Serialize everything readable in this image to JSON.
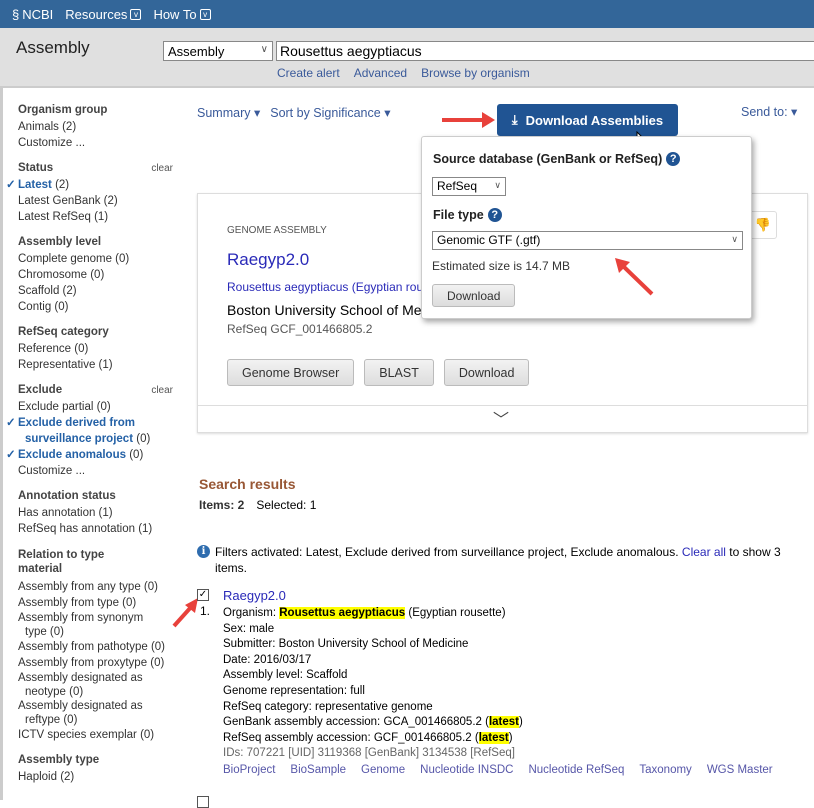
{
  "header": {
    "logo": "NCBI",
    "menus": [
      "Resources",
      "How To"
    ]
  },
  "search": {
    "db_title": "Assembly",
    "db_select": "Assembly",
    "query": "Rousettus aegyptiacus",
    "links": [
      "Create alert",
      "Advanced",
      "Browse by organism"
    ]
  },
  "sidebar": {
    "organism_group": {
      "title": "Organism group",
      "items": [
        "Animals (2)",
        "Customize ..."
      ]
    },
    "status": {
      "title": "Status",
      "clear": "clear",
      "checked": "Latest",
      "checked_count": "(2)",
      "items": [
        "Latest GenBank (2)",
        "Latest RefSeq (1)"
      ]
    },
    "assembly_level": {
      "title": "Assembly level",
      "items": [
        "Complete genome (0)",
        "Chromosome (0)",
        "Scaffold (2)",
        "Contig (0)"
      ]
    },
    "refseq_category": {
      "title": "RefSeq category",
      "items": [
        "Reference (0)",
        "Representative (1)"
      ]
    },
    "exclude": {
      "title": "Exclude",
      "clear": "clear",
      "item1": "Exclude partial (0)",
      "checked1": "Exclude derived from",
      "checked1b": "surveillance project",
      "checked1_count": "(0)",
      "checked2": "Exclude anomalous",
      "checked2_count": "(0)",
      "customize": "Customize ..."
    },
    "annotation_status": {
      "title": "Annotation status",
      "items": [
        "Has annotation (1)",
        "RefSeq has annotation (1)"
      ]
    },
    "relation": {
      "title1": "Relation to type",
      "title2": "material",
      "items": [
        "Assembly from any type (0)",
        "Assembly from type (0)",
        "Assembly from synonym",
        "type (0)",
        "Assembly from pathotype (0)",
        "Assembly from proxytype (0)",
        "Assembly designated as",
        "neotype (0)",
        "Assembly designated as",
        "reftype (0)",
        "ICTV species exemplar (0)"
      ]
    },
    "assembly_type": {
      "title": "Assembly type",
      "items": [
        "Haploid (2)"
      ]
    }
  },
  "toolbar": {
    "summary": "Summary",
    "sort": "Sort by Significance",
    "send_to": "Send to:",
    "download_assemblies": "Download Assemblies"
  },
  "card": {
    "label": "GENOME ASSEMBLY",
    "title": "Raegyp2.0",
    "organism": "Rousettus aegyptiacus (Egyptian rousette)",
    "submitter": "Boston University School of Medicine",
    "accession": "RefSeq GCF_001466805.2",
    "buttons": [
      "Genome Browser",
      "BLAST",
      "Download"
    ]
  },
  "popup": {
    "source_label": "Source database (GenBank or RefSeq)",
    "source_value": "RefSeq",
    "filetype_label": "File type",
    "filetype_value": "Genomic GTF (.gtf)",
    "estimate": "Estimated size is 14.7 MB",
    "download": "Download"
  },
  "results": {
    "title": "Search results",
    "items": "Items: 2",
    "selected": "Selected: 1",
    "filters_text": "Filters activated: Latest, Exclude derived from surveillance project, Exclude anomalous.",
    "clear_all": "Clear all",
    "filters_tail": "to show 3 items."
  },
  "item1": {
    "number": "1.",
    "title": "Raegyp2.0",
    "organism_label": "Organism:",
    "organism": "Rousettus aegyptiacus",
    "organism_common": "(Egyptian rousette)",
    "sex": "Sex: male",
    "submitter": "Submitter: Boston University School of Medicine",
    "date": "Date: 2016/03/17",
    "level": "Assembly level: Scaffold",
    "representation": "Genome representation: full",
    "category": "RefSeq category: representative genome",
    "genbank_label": "GenBank assembly accession: GCA_001466805.2 (",
    "refseq_label": "RefSeq assembly accession: GCF_001466805.2 (",
    "latest": "latest",
    "close_paren": ")",
    "ids": "IDs: 707221 [UID] 3119368 [GenBank] 3134538 [RefSeq]",
    "links": [
      "BioProject",
      "BioSample",
      "Genome",
      "Nucleotide INSDC",
      "Nucleotide RefSeq",
      "Taxonomy",
      "WGS Master"
    ]
  },
  "colors": {
    "header": "#336699",
    "button": "#205493",
    "results_title": "#985735",
    "highlight": "#ffff00",
    "arrow": "#e8413b"
  }
}
